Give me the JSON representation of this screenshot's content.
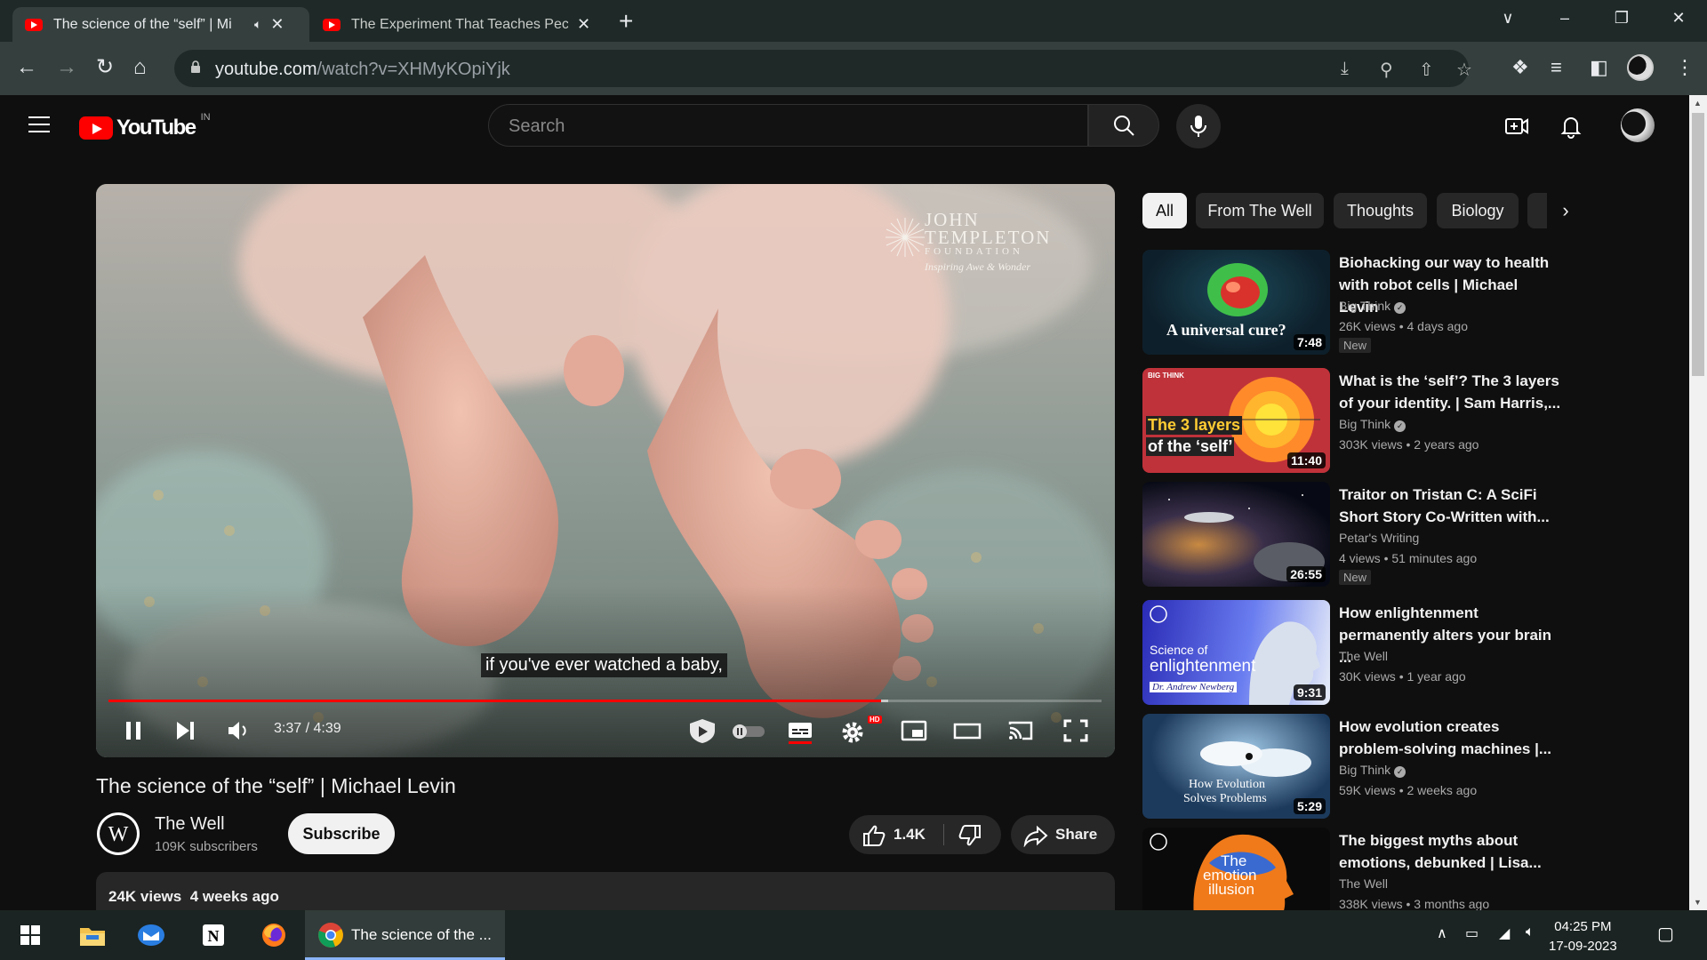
{
  "browser": {
    "tabs": [
      {
        "title": "The science of the “self” | Mi",
        "audio": "speaker-muted-icon",
        "active": true
      },
      {
        "title": "The Experiment That Teaches Pec",
        "active": false
      }
    ],
    "url_host": "youtube.com",
    "url_path": "/watch?v=XHMyKOpiYjk"
  },
  "masthead": {
    "logo_text": "YouTube",
    "country_code": "IN",
    "search_placeholder": "Search"
  },
  "player": {
    "brand_line1": "JOHN",
    "brand_line2": "TEMPLETON",
    "brand_line3": "FOUNDATION",
    "brand_tagline": "Inspiring Awe & Wonder",
    "caption": "if you've ever watched a baby,",
    "time_display": "3:37 / 4:39",
    "played_fraction": 0.778,
    "loaded_fraction": 0.785,
    "hd_badge": "HD"
  },
  "video": {
    "title": "The science of the “self” | Michael Levin",
    "channel_name": "The Well",
    "channel_subscribers": "109K subscribers",
    "subscribe_label": "Subscribe",
    "like_count": "1.4K",
    "share_label": "Share",
    "views": "24K views",
    "age": "4 weeks ago"
  },
  "chips": [
    "All",
    "From The Well",
    "Thoughts",
    "Biology"
  ],
  "recommendations": [
    {
      "title": "Biohacking our way to health with robot cells | Michael Levin",
      "channel": "Big Think",
      "verified": true,
      "views": "26K views",
      "age": "4 days ago",
      "badge": "New",
      "duration": "7:48",
      "thumb_text": "A universal cure?"
    },
    {
      "title": "What is the ‘self’? The 3 layers of your identity. | Sam Harris,...",
      "channel": "Big Think",
      "verified": true,
      "views": "303K views",
      "age": "2 years ago",
      "badge": "",
      "duration": "11:40",
      "thumb_text1": "The 3 layers",
      "thumb_text2": "of the ‘self’",
      "thumb_logo": "BIG THINK"
    },
    {
      "title": "Traitor on Tristan C: A SciFi Short Story Co-Written with...",
      "channel": "Petar's Writing",
      "verified": false,
      "views": "4 views",
      "age": "51 minutes ago",
      "badge": "New",
      "duration": "26:55"
    },
    {
      "title": "How enlightenment permanently alters your brain ...",
      "channel": "The Well",
      "verified": false,
      "views": "30K views",
      "age": "1 year ago",
      "badge": "",
      "duration": "9:31",
      "thumb_text1": "Science of",
      "thumb_text2": "enlightenment",
      "thumb_text3": "Dr. Andrew Newberg"
    },
    {
      "title": "How evolution creates problem-solving machines |...",
      "channel": "Big Think",
      "verified": true,
      "views": "59K views",
      "age": "2 weeks ago",
      "badge": "",
      "duration": "5:29",
      "thumb_text1": "How Evolution",
      "thumb_text2": "Solves Problems"
    },
    {
      "title": "The biggest myths about emotions, debunked | Lisa...",
      "channel": "The Well",
      "verified": false,
      "views": "338K views",
      "age": "3 months ago",
      "badge": "",
      "duration": "",
      "thumb_text1": "The",
      "thumb_text2": "emotion",
      "thumb_text3": "illusion"
    }
  ],
  "taskbar": {
    "chrome_label": "The science of the ...",
    "time": "04:25 PM",
    "date": "17-09-2023"
  },
  "colors": {
    "accent_red": "#ff0000",
    "background": "#0f0f0f",
    "chip_bg": "#272727"
  }
}
